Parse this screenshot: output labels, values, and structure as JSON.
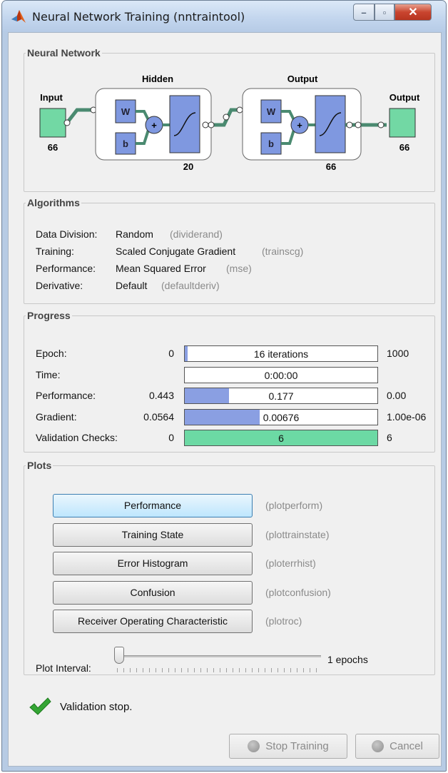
{
  "window": {
    "title": "Neural Network Training (nntraintool)"
  },
  "network": {
    "legend": "Neural Network",
    "input_label": "Input",
    "input_size": "66",
    "hidden_label": "Hidden",
    "hidden_size": "20",
    "output_layer_label": "Output",
    "output_layer_size": "66",
    "output_label": "Output",
    "output_size": "66",
    "w": "W",
    "b": "b",
    "plus": "+"
  },
  "algorithms": {
    "legend": "Algorithms",
    "rows": [
      {
        "label": "Data Division:",
        "value": "Random",
        "fn": "(dividerand)"
      },
      {
        "label": "Training:",
        "value": "Scaled Conjugate Gradient",
        "fn": "(trainscg)"
      },
      {
        "label": "Performance:",
        "value": "Mean Squared Error",
        "fn": "(mse)"
      },
      {
        "label": "Derivative:",
        "value": "Default",
        "fn": "(defaultderiv)"
      }
    ]
  },
  "progress": {
    "legend": "Progress",
    "rows": [
      {
        "label": "Epoch:",
        "start": "0",
        "current": "16 iterations",
        "end": "1000",
        "fill": 0.016,
        "color": "#8a9fe2"
      },
      {
        "label": "Time:",
        "start": "",
        "current": "0:00:00",
        "end": "",
        "fill": 0,
        "color": "#8a9fe2"
      },
      {
        "label": "Performance:",
        "start": "0.443",
        "current": "0.177",
        "end": "0.00",
        "fill": 0.23,
        "color": "#8a9fe2"
      },
      {
        "label": "Gradient:",
        "start": "0.0564",
        "current": "0.00676",
        "end": "1.00e-06",
        "fill": 0.39,
        "color": "#8a9fe2"
      },
      {
        "label": "Validation Checks:",
        "start": "0",
        "current": "6",
        "end": "6",
        "fill": 1.0,
        "color": "#6cd9a4"
      }
    ]
  },
  "plots": {
    "legend": "Plots",
    "buttons": [
      {
        "label": "Performance",
        "fn": "(plotperform)"
      },
      {
        "label": "Training State",
        "fn": "(plottrainstate)"
      },
      {
        "label": "Error Histogram",
        "fn": "(ploterrhist)"
      },
      {
        "label": "Confusion",
        "fn": "(plotconfusion)"
      },
      {
        "label": "Receiver Operating Characteristic",
        "fn": "(plotroc)"
      }
    ],
    "interval_label": "Plot Interval:",
    "interval_value": "1 epochs",
    "interval_fraction": 0.0
  },
  "status": {
    "text": "Validation stop."
  },
  "footer": {
    "stop_label": "Stop Training",
    "cancel_label": "Cancel"
  }
}
